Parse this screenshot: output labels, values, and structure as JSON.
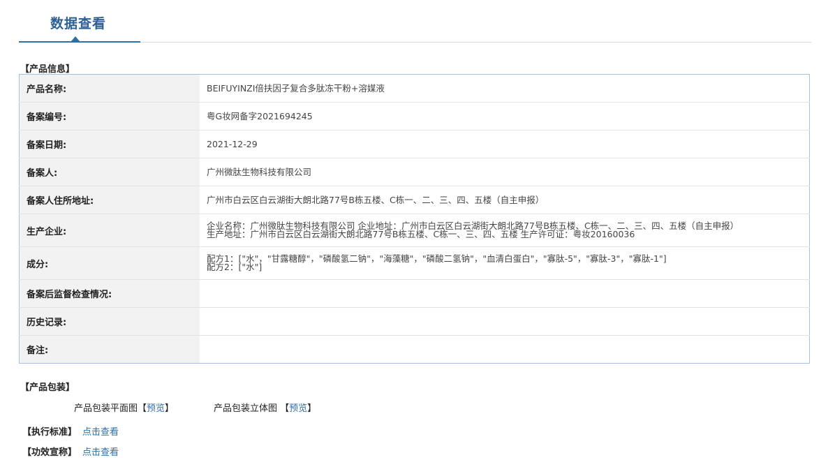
{
  "header": {
    "tab_title": "数据查看"
  },
  "product_info": {
    "section_label": "【产品信息】",
    "rows": [
      {
        "label": "产品名称:",
        "value": [
          "BEIFUYINZI倍扶因子复合多肽冻干粉+溶媒液"
        ]
      },
      {
        "label": "备案编号:",
        "value": [
          "粤G妆网备字2021694245"
        ]
      },
      {
        "label": "备案日期:",
        "value": [
          "2021-12-29"
        ]
      },
      {
        "label": "备案人:",
        "value": [
          "广州微肽生物科技有限公司"
        ]
      },
      {
        "label": "备案人住所地址:",
        "value": [
          "广州市白云区白云湖街大朗北路77号B栋五楼、C栋一、二、三、四、五楼（自主申报）"
        ]
      },
      {
        "label": "生产企业:",
        "value": [
          "企业名称：广州微肽生物科技有限公司 企业地址：广州市白云区白云湖街大朗北路77号B栋五楼、C栋一、二、三、四、五楼（自主申报）",
          "生产地址：广州市白云区白云湖街大朗北路77号B栋五楼、C栋一、三、四、五楼 生产许可证：粤妆20160036"
        ]
      },
      {
        "label": "成分:",
        "value": [
          "配方1：[\"水\"，\"甘露糖醇\"，\"磷酸氢二钠\"，\"海藻糖\"，\"磷酸二氢钠\"，\"血清白蛋白\"，\"寡肽-5\"，\"寡肽-3\"，\"寡肽-1\"]",
          "配方2：[\"水\"]"
        ]
      },
      {
        "label": "备案后监督检查情况:",
        "value": []
      },
      {
        "label": "历史记录:",
        "value": []
      },
      {
        "label": "备注:",
        "value": []
      }
    ]
  },
  "packaging": {
    "section_label": "【产品包装】",
    "flat_label": "产品包装平面图",
    "flat_link": "预览",
    "solid_label": "产品包装立体图",
    "solid_link": "预览"
  },
  "standard": {
    "label": "【执行标准】",
    "link": "点击查看"
  },
  "efficacy": {
    "label": "【功效宣称】",
    "link": "点击查看"
  }
}
